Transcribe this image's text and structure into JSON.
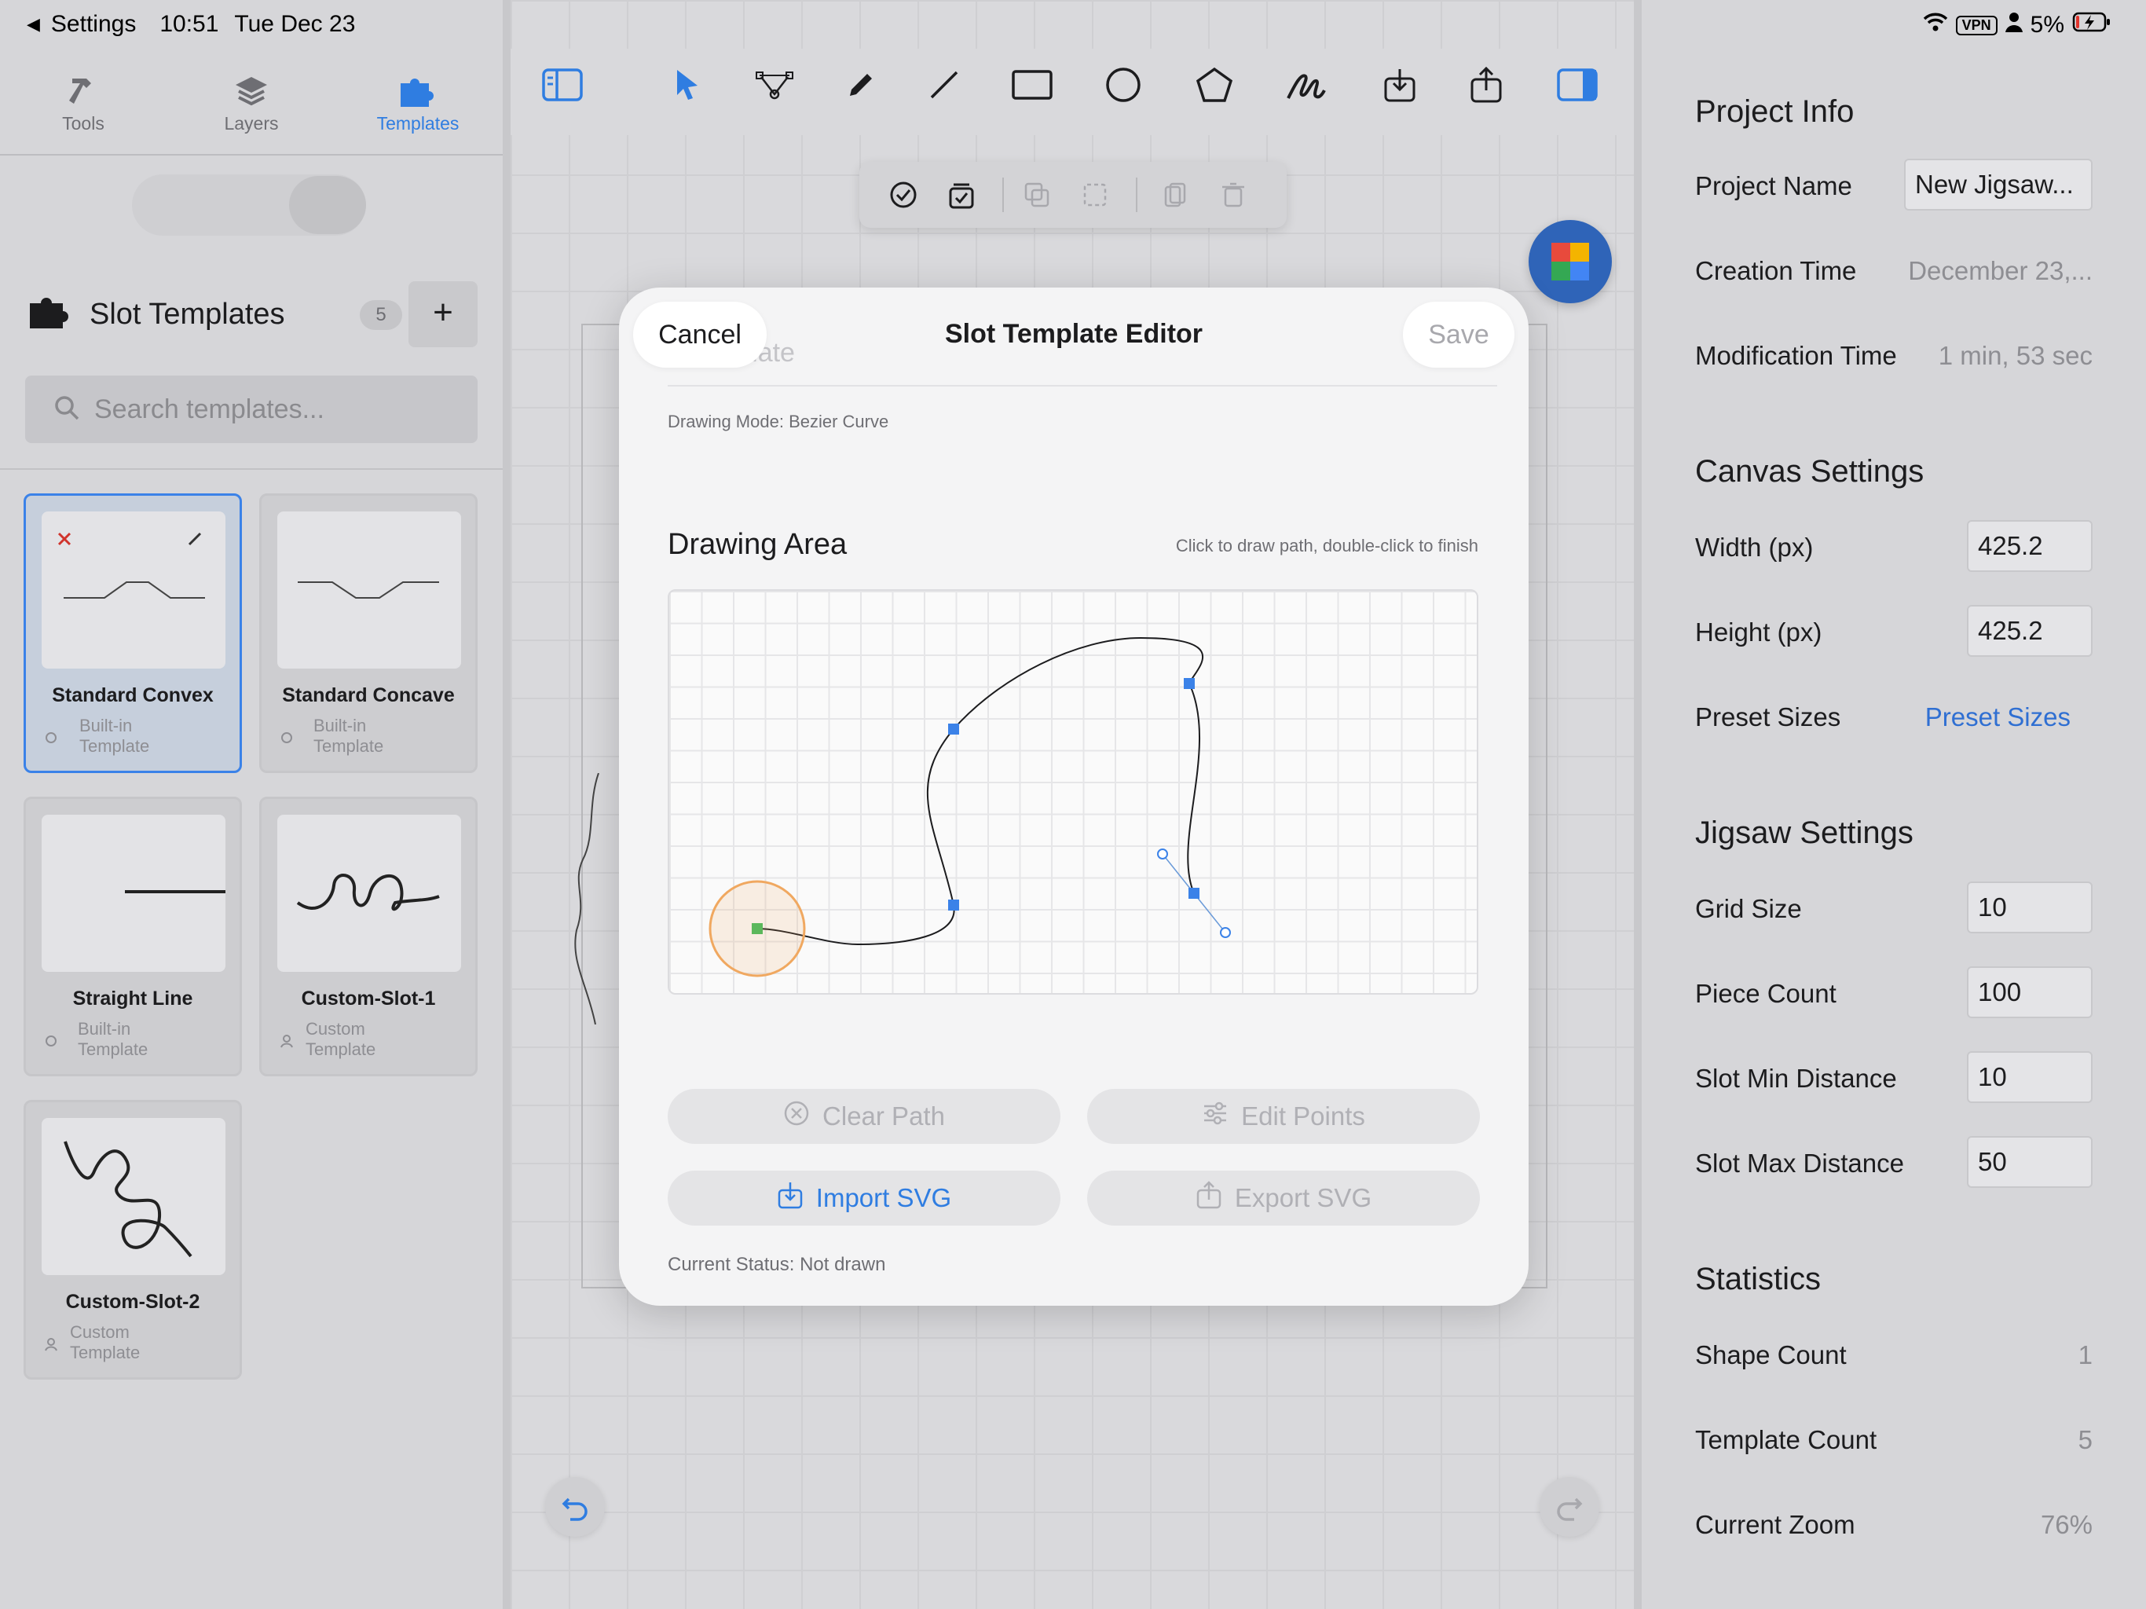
{
  "status_bar": {
    "back_label": "Settings",
    "time": "10:51",
    "date": "Tue Dec 23",
    "vpn": "VPN",
    "battery": "5%"
  },
  "sidebar": {
    "tabs": [
      {
        "label": "Tools"
      },
      {
        "label": "Layers"
      },
      {
        "label": "Templates"
      }
    ],
    "slot_templates_title": "Slot Templates",
    "count": "5",
    "add_label": "+",
    "search_placeholder": "Search templates...",
    "templates": [
      {
        "name": "Standard Convex",
        "kind": "Built-in",
        "sub": "Template"
      },
      {
        "name": "Standard Concave",
        "kind": "Built-in",
        "sub": "Template"
      },
      {
        "name": "Straight Line",
        "kind": "Built-in",
        "sub": "Template"
      },
      {
        "name": "Custom-Slot-1",
        "kind": "Custom",
        "sub": "Template"
      },
      {
        "name": "Custom-Slot-2",
        "kind": "Custom",
        "sub": "Template"
      }
    ]
  },
  "modal": {
    "cancel": "Cancel",
    "title": "Slot Template Editor",
    "save": "Save",
    "ghost_field": "Template",
    "drawing_mode": "Drawing Mode: Bezier Curve",
    "drawing_area_title": "Drawing Area",
    "drawing_hint": "Click to draw path, double-click to finish",
    "buttons": {
      "clear": "Clear Path",
      "edit": "Edit Points",
      "import": "Import SVG",
      "export": "Export SVG"
    },
    "current_status": "Current Status: Not drawn"
  },
  "right_panel": {
    "project_info": "Project Info",
    "project_name_label": "Project Name",
    "project_name_value": "New Jigsaw...",
    "creation_time_label": "Creation Time",
    "creation_time_value": "December 23,...",
    "modification_time_label": "Modification Time",
    "modification_time_value": "1 min, 53 sec",
    "canvas_settings": "Canvas Settings",
    "width_label": "Width (px)",
    "width_value": "425.2",
    "height_label": "Height (px)",
    "height_value": "425.2",
    "preset_sizes_label": "Preset Sizes",
    "preset_sizes_link": "Preset Sizes",
    "jigsaw_settings": "Jigsaw Settings",
    "grid_size_label": "Grid Size",
    "grid_size_value": "10",
    "piece_count_label": "Piece Count",
    "piece_count_value": "100",
    "slot_min_label": "Slot Min Distance",
    "slot_min_value": "10",
    "slot_max_label": "Slot Max Distance",
    "slot_max_value": "50",
    "statistics": "Statistics",
    "shape_count_label": "Shape Count",
    "shape_count_value": "1",
    "template_count_label": "Template Count",
    "template_count_value": "5",
    "current_zoom_label": "Current Zoom",
    "current_zoom_value": "76%"
  },
  "colors": {
    "accent": "#2f7de1",
    "anchor": "#3b82e8",
    "start_point": "#5cb85c",
    "start_ring": "#f0a860"
  }
}
